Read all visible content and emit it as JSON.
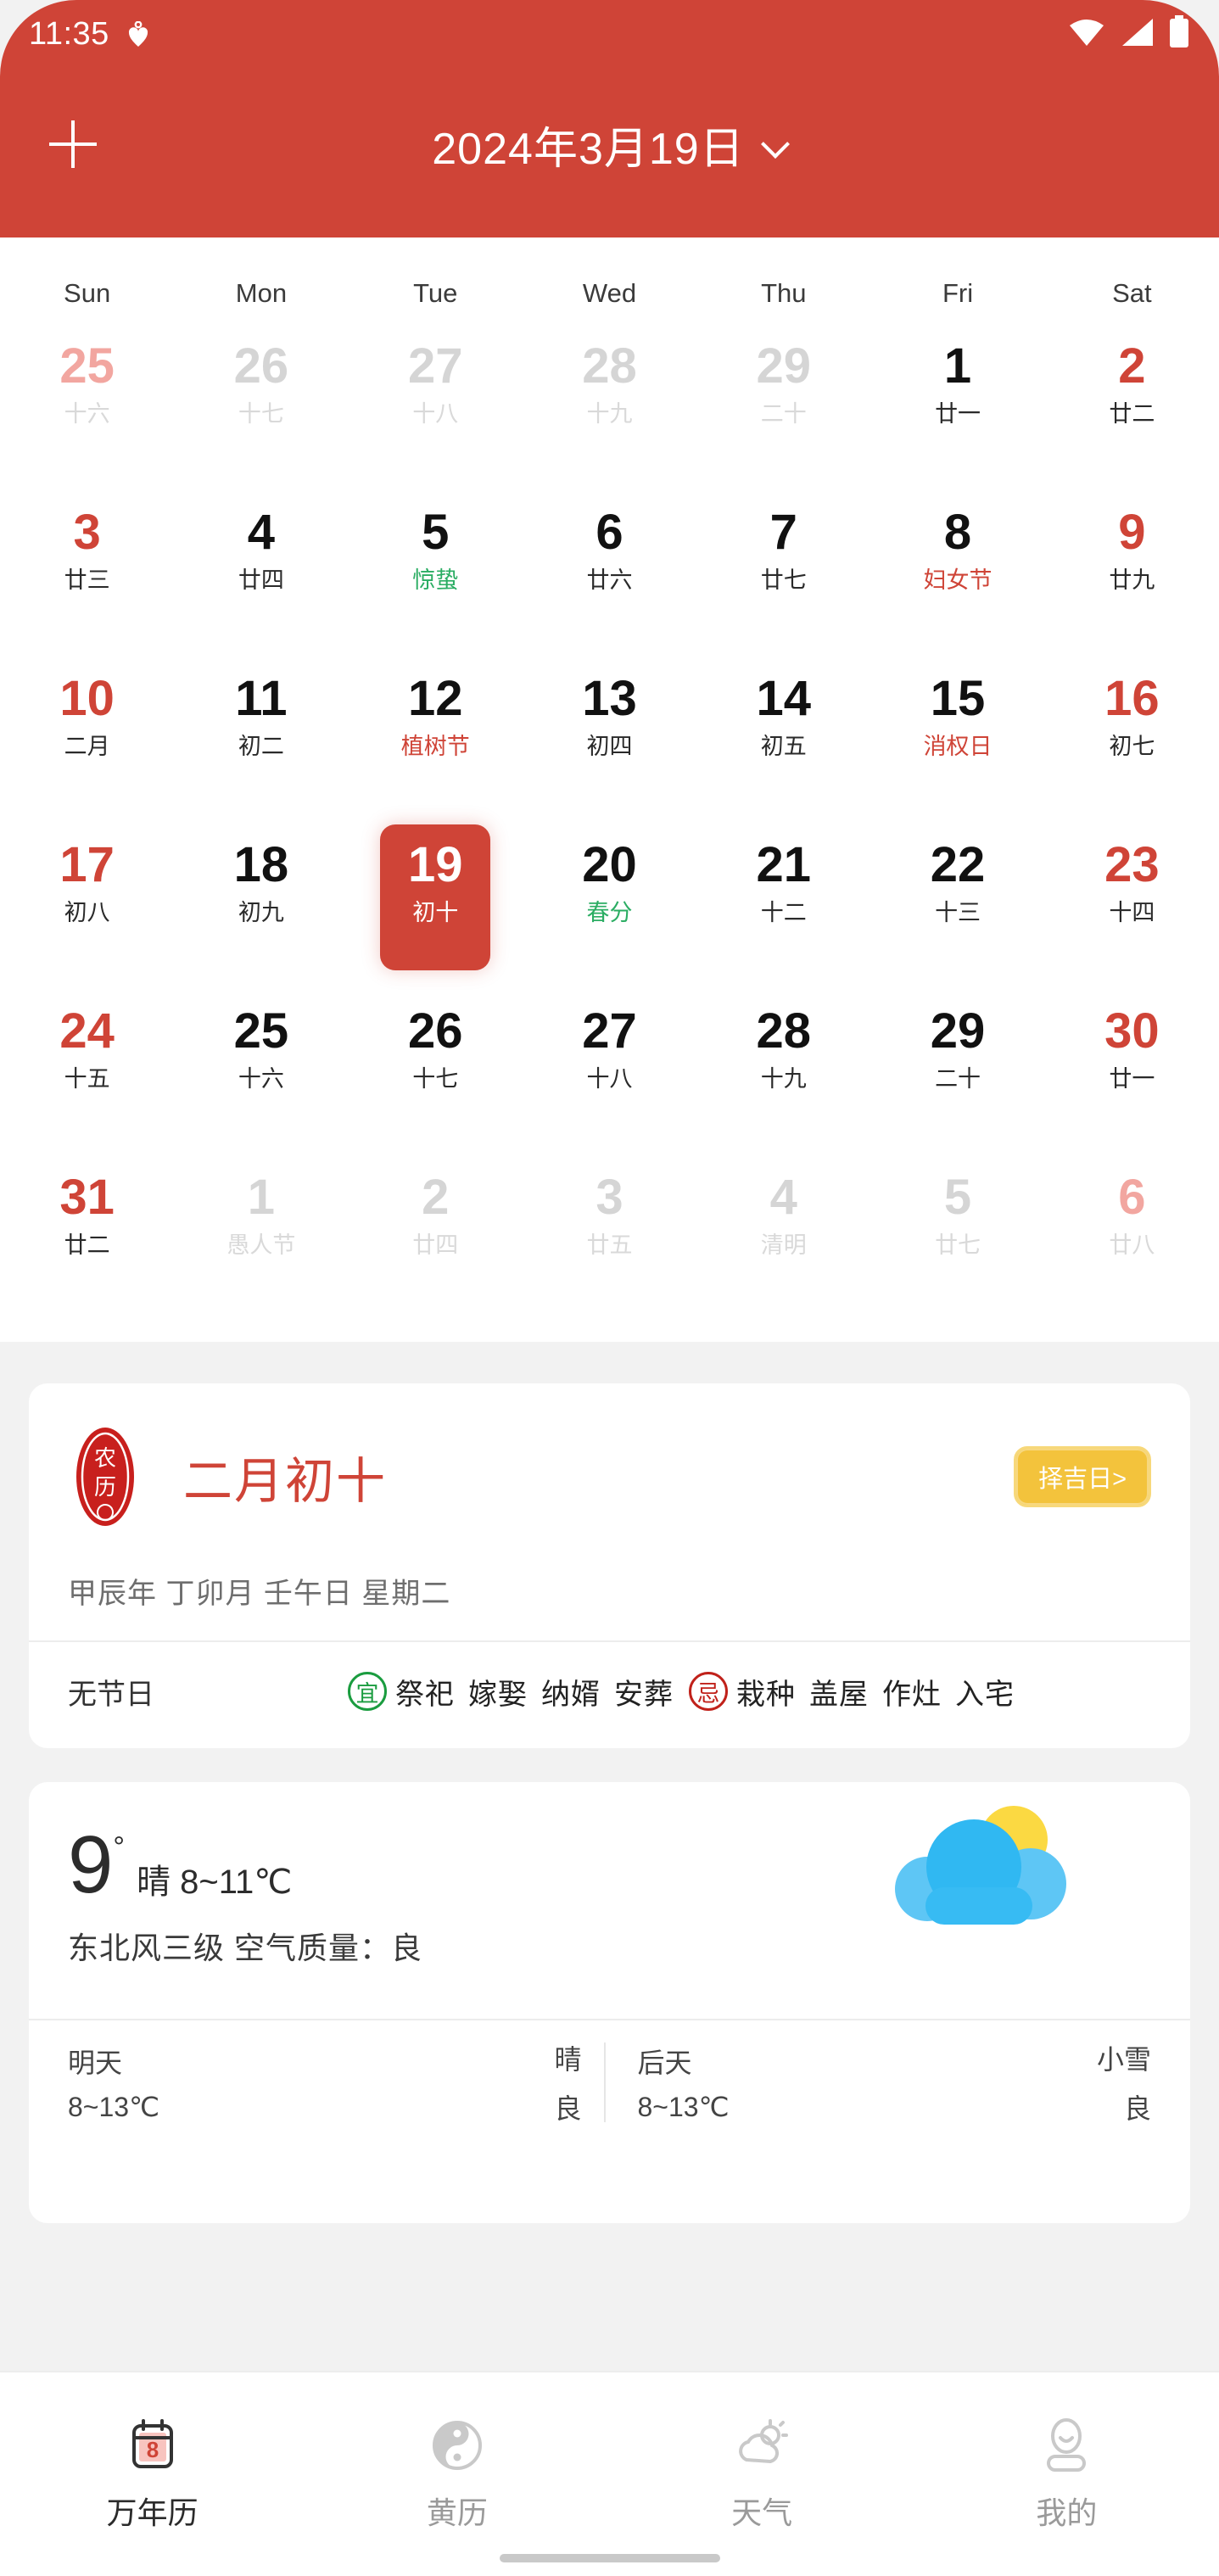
{
  "status_bar": {
    "time": "11:35",
    "heart_icon": "heart-icon",
    "wifi_icon": "wifi-icon",
    "signal_icon": "signal-icon",
    "battery_icon": "battery-icon"
  },
  "header": {
    "add_label": "+",
    "title": "2024年3月19日",
    "chevron_icon": "chevron-down-icon"
  },
  "calendar": {
    "weekdays": [
      "Sun",
      "Mon",
      "Tue",
      "Wed",
      "Thu",
      "Fri",
      "Sat"
    ],
    "days": [
      {
        "num": "25",
        "lunar": "十六",
        "other": true,
        "weekend": true
      },
      {
        "num": "26",
        "lunar": "十七",
        "other": true
      },
      {
        "num": "27",
        "lunar": "十八",
        "other": true
      },
      {
        "num": "28",
        "lunar": "十九",
        "other": true
      },
      {
        "num": "29",
        "lunar": "二十",
        "other": true
      },
      {
        "num": "1",
        "lunar": "廿一"
      },
      {
        "num": "2",
        "lunar": "廿二",
        "weekend": true
      },
      {
        "num": "3",
        "lunar": "廿三",
        "weekend": true
      },
      {
        "num": "4",
        "lunar": "廿四"
      },
      {
        "num": "5",
        "lunar": "惊蛰",
        "kind": "term"
      },
      {
        "num": "6",
        "lunar": "廿六"
      },
      {
        "num": "7",
        "lunar": "廿七"
      },
      {
        "num": "8",
        "lunar": "妇女节",
        "kind": "fest"
      },
      {
        "num": "9",
        "lunar": "廿九",
        "weekend": true
      },
      {
        "num": "10",
        "lunar": "二月",
        "weekend": true
      },
      {
        "num": "11",
        "lunar": "初二"
      },
      {
        "num": "12",
        "lunar": "植树节",
        "kind": "fest"
      },
      {
        "num": "13",
        "lunar": "初四"
      },
      {
        "num": "14",
        "lunar": "初五"
      },
      {
        "num": "15",
        "lunar": "消权日",
        "kind": "fest"
      },
      {
        "num": "16",
        "lunar": "初七",
        "weekend": true
      },
      {
        "num": "17",
        "lunar": "初八",
        "weekend": true
      },
      {
        "num": "18",
        "lunar": "初九"
      },
      {
        "num": "19",
        "lunar": "初十",
        "selected": true
      },
      {
        "num": "20",
        "lunar": "春分",
        "kind": "term"
      },
      {
        "num": "21",
        "lunar": "十二"
      },
      {
        "num": "22",
        "lunar": "十三"
      },
      {
        "num": "23",
        "lunar": "十四",
        "weekend": true
      },
      {
        "num": "24",
        "lunar": "十五",
        "weekend": true
      },
      {
        "num": "25",
        "lunar": "十六"
      },
      {
        "num": "26",
        "lunar": "十七"
      },
      {
        "num": "27",
        "lunar": "十八"
      },
      {
        "num": "28",
        "lunar": "十九"
      },
      {
        "num": "29",
        "lunar": "二十"
      },
      {
        "num": "30",
        "lunar": "廿一",
        "weekend": true
      },
      {
        "num": "31",
        "lunar": "廿二",
        "weekend": true
      },
      {
        "num": "1",
        "lunar": "愚人节",
        "other": true,
        "kind": "fest"
      },
      {
        "num": "2",
        "lunar": "廿四",
        "other": true
      },
      {
        "num": "3",
        "lunar": "廿五",
        "other": true
      },
      {
        "num": "4",
        "lunar": "清明",
        "other": true,
        "kind": "term"
      },
      {
        "num": "5",
        "lunar": "廿七",
        "other": true
      },
      {
        "num": "6",
        "lunar": "廿八",
        "other": true,
        "weekend": true
      }
    ]
  },
  "lunar_card": {
    "seal_icon": "lunar-seal-icon",
    "seal_text": "农历",
    "title": "二月初十",
    "lucky_button": "择吉日>",
    "ganzhi": "甲辰年 丁卯月 壬午日 星期二",
    "festival": "无节日",
    "yi_badge": "宜",
    "yi_items": [
      "祭祀",
      "嫁娶",
      "纳婿",
      "安葬"
    ],
    "ji_badge": "忌",
    "ji_items": [
      "栽种",
      "盖屋",
      "作灶",
      "入宅"
    ]
  },
  "weather_card": {
    "temp": "9",
    "degree": "°",
    "condition_range": "晴 8~11℃",
    "detail": "东北风三级  空气质量：良",
    "icon": "sun-behind-cloud-icon",
    "forecast": [
      {
        "day": "明天",
        "range": "8~13℃",
        "condition": "晴",
        "air": "良"
      },
      {
        "day": "后天",
        "range": "8~13℃",
        "condition": "小雪",
        "air": "良"
      }
    ]
  },
  "tabbar": {
    "tabs": [
      {
        "label": "万年历",
        "icon": "calendar-icon",
        "badge": "8",
        "active": true
      },
      {
        "label": "黄历",
        "icon": "yinyang-icon",
        "active": false
      },
      {
        "label": "天气",
        "icon": "cloud-sun-icon",
        "active": false
      },
      {
        "label": "我的",
        "icon": "person-icon",
        "active": false
      }
    ]
  },
  "colors": {
    "brand_red": "#cf4437",
    "term_green": "#2bad63",
    "gold": "#f3c33c"
  }
}
